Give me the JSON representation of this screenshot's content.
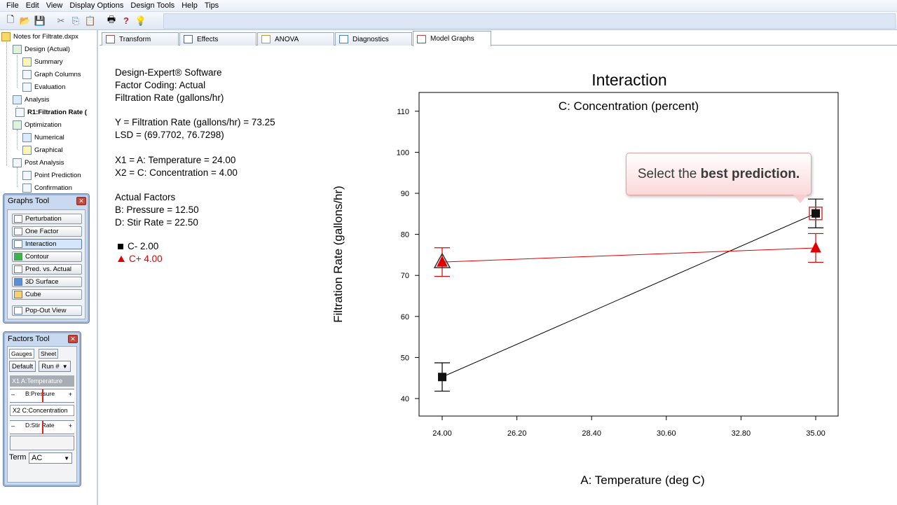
{
  "menu": [
    "File",
    "Edit",
    "View",
    "Display Options",
    "Design Tools",
    "Help",
    "Tips"
  ],
  "tree": {
    "root": "Notes for Filtrate.dxpx",
    "items": [
      {
        "label": "Design (Actual)"
      },
      {
        "label": "Summary"
      },
      {
        "label": "Graph Columns"
      },
      {
        "label": "Evaluation"
      },
      {
        "label": "Analysis"
      },
      {
        "label": "R1:Filtration Rate ("
      },
      {
        "label": "Optimization"
      },
      {
        "label": "Numerical"
      },
      {
        "label": "Graphical"
      },
      {
        "label": "Post Analysis"
      },
      {
        "label": "Point Prediction"
      },
      {
        "label": "Confirmation"
      }
    ]
  },
  "graphs_tool": {
    "title": "Graphs Tool",
    "buttons": [
      "Perturbation",
      "One Factor",
      "Interaction",
      "Contour",
      "Pred. vs. Actual",
      "3D Surface",
      "Cube",
      "Pop-Out View"
    ],
    "active": "Interaction"
  },
  "factors_tool": {
    "title": "Factors Tool",
    "tab_gauges": "Gauges",
    "tab_sheet": "Sheet",
    "default_btn": "Default",
    "run_btn": "Run #",
    "rows": [
      "X1 A:Temperature",
      "B:Pressure",
      "X2 C:Concentration",
      "D:Stir Rate"
    ],
    "term_label": "Term",
    "term_value": "AC"
  },
  "tabs": [
    "Transform",
    "Effects",
    "ANOVA",
    "Diagnostics",
    "Model Graphs"
  ],
  "active_tab": "Model Graphs",
  "info": {
    "software": "Design-Expert® Software",
    "coding": "Factor Coding: Actual",
    "response": "Filtration Rate (gallons/hr)",
    "y_line": "Y = Filtration Rate (gallons/hr) = 73.25",
    "lsd_line": "LSD = (69.7702, 76.7298)",
    "x1_line": "X1 = A: Temperature = 24.00",
    "x2_line": "X2 = C: Concentration = 4.00",
    "actual_factors": "Actual Factors",
    "b_line": "B: Pressure = 12.50",
    "d_line": "D: Stir Rate = 22.50",
    "legend_low": "C- 2.00",
    "legend_high": "C+ 4.00"
  },
  "colors": {
    "low_series": "#000000",
    "high_series": "#e00000",
    "callout_border": "#e2a0a0"
  },
  "callout": {
    "prefix": "Select the ",
    "bold": "best prediction."
  },
  "chart_data": {
    "type": "line",
    "title": "Interaction",
    "subtitle": "C: Concentration (percent)",
    "xlabel": "A: Temperature (deg C)",
    "ylabel": "Filtration Rate (gallons/hr)",
    "xlim": [
      24,
      35
    ],
    "ylim": [
      35,
      115
    ],
    "xticks": [
      "24.00",
      "26.20",
      "28.40",
      "30.60",
      "32.80",
      "35.00"
    ],
    "xtick_values": [
      24,
      26.2,
      28.4,
      30.6,
      32.8,
      35
    ],
    "yticks": [
      40,
      50,
      60,
      70,
      80,
      90,
      100,
      110
    ],
    "series": [
      {
        "name": "C- 2.00",
        "x": [
          24,
          35
        ],
        "y": [
          45.25,
          85.1
        ],
        "lsd": [
          [
            41.8,
            48.7
          ],
          [
            81.6,
            88.6
          ]
        ]
      },
      {
        "name": "C+ 4.00",
        "x": [
          24,
          35
        ],
        "y": [
          73.25,
          76.7
        ],
        "lsd": [
          [
            69.77,
            76.73
          ],
          [
            73.2,
            80.2
          ]
        ]
      }
    ],
    "grid": false
  }
}
